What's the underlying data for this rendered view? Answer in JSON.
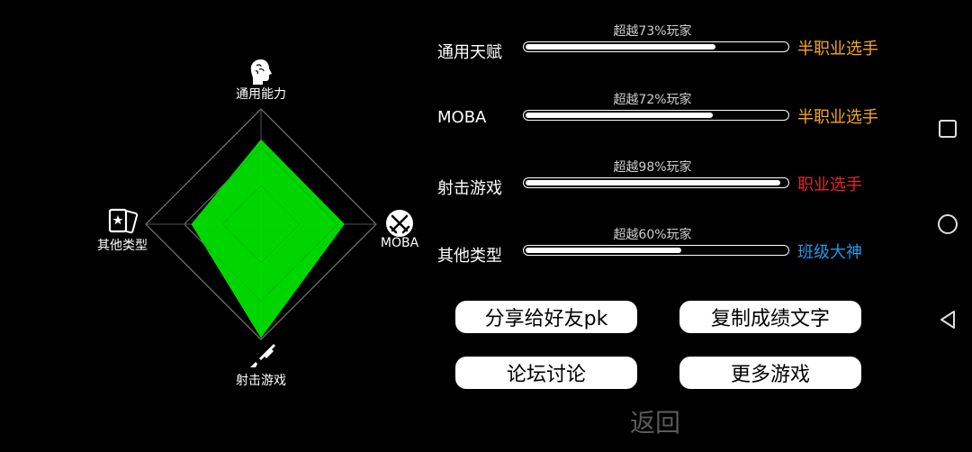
{
  "radar": {
    "axes": [
      {
        "label": "通用能力",
        "icon": "head-brain-icon",
        "value": 0.73
      },
      {
        "label": "MOBA",
        "icon": "crossed-swords-icon",
        "value": 0.72
      },
      {
        "label": "射击游戏",
        "icon": "rifle-icon",
        "value": 0.98
      },
      {
        "label": "其他类型",
        "icon": "playing-cards-icon",
        "value": 0.6
      }
    ],
    "fill_color": "#00e000"
  },
  "stats": [
    {
      "name": "通用天赋",
      "percentile_text": "超越73%玩家",
      "value": 0.73,
      "rank": "半职业选手",
      "rank_color": "#f5a623"
    },
    {
      "name": "MOBA",
      "percentile_text": "超越72%玩家",
      "value": 0.72,
      "rank": "半职业选手",
      "rank_color": "#f5a623"
    },
    {
      "name": "射击游戏",
      "percentile_text": "超越98%玩家",
      "value": 0.98,
      "rank": "职业选手",
      "rank_color": "#e8202a"
    },
    {
      "name": "其他类型",
      "percentile_text": "超越60%玩家",
      "value": 0.6,
      "rank": "班级大神",
      "rank_color": "#1e9be8"
    }
  ],
  "buttons": {
    "share": "分享给好友pk",
    "copy": "复制成绩文字",
    "forum": "论坛讨论",
    "more": "更多游戏"
  },
  "back": "返回",
  "nav_icons": [
    "recent-apps-icon",
    "home-icon",
    "back-icon"
  ]
}
